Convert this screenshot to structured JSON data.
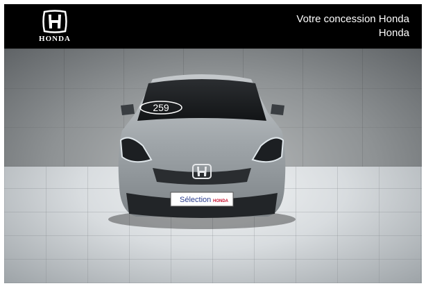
{
  "header": {
    "logo_text": "HONDA",
    "dealer_line1": "Votre concession Honda",
    "dealer_line2": "Honda"
  },
  "vehicle": {
    "windshield_sticker": "259",
    "plate_text": "Sélection",
    "plate_brand": "HONDA"
  },
  "colors": {
    "header_bg": "#000000",
    "header_text": "#ffffff",
    "plate_blue": "#2a3d8f",
    "plate_red": "#c8102e"
  }
}
